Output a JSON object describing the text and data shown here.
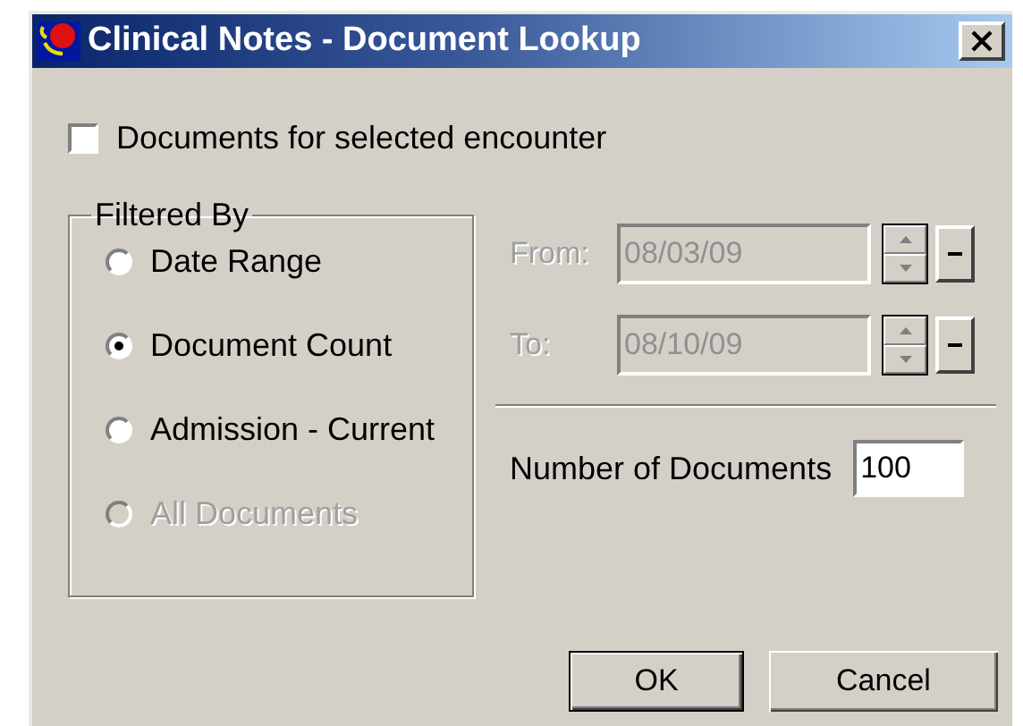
{
  "window": {
    "title": "Clinical Notes - Document Lookup"
  },
  "encounter_checkbox": {
    "label": "Documents for selected encounter",
    "checked": false
  },
  "filter_group": {
    "title": "Filtered By",
    "options": [
      {
        "label": "Date Range",
        "selected": false,
        "disabled": false
      },
      {
        "label": "Document Count",
        "selected": true,
        "disabled": false
      },
      {
        "label": "Admission - Current",
        "selected": false,
        "disabled": false
      },
      {
        "label": "All Documents",
        "selected": false,
        "disabled": true
      }
    ]
  },
  "date_fields": [
    {
      "label": "From:",
      "value": "08/03/09",
      "disabled": true
    },
    {
      "label": "To:",
      "value": "08/10/09",
      "disabled": true
    }
  ],
  "document_count": {
    "label": "Number of Documents",
    "value": "100"
  },
  "buttons": [
    {
      "label": "OK",
      "default": true
    },
    {
      "label": "Cancel",
      "default": false
    }
  ]
}
